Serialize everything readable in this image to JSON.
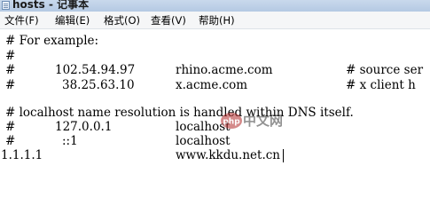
{
  "window": {
    "title": "hosts - 记事本"
  },
  "menu": {
    "file": "文件(F)",
    "edit": "编辑(E)",
    "format": "格式(O)",
    "view": "查看(V)",
    "help": "帮助(H)"
  },
  "editor": {
    "lines": [
      {
        "text": "# For example:"
      },
      {
        "text": "#"
      },
      {
        "hash": "#",
        "ip": "102.54.94.97",
        "host": "rhino.acme.com",
        "comment": "# source ser"
      },
      {
        "hash": "#",
        "ip": "38.25.63.10",
        "host": "x.acme.com",
        "comment": "# x client h"
      },
      {
        "text": ""
      },
      {
        "text": "# localhost name resolution is handled within DNS itself."
      },
      {
        "hash": "#",
        "ip": "127.0.0.1",
        "host": "localhost"
      },
      {
        "hash": "#",
        "ip": "::1",
        "host": "localhost"
      },
      {
        "ip": "1.1.1.1",
        "host": "www.kkdu.net.cn"
      }
    ]
  },
  "watermark": {
    "logo_text": "php",
    "text": "中文网",
    "logo_color": "#b22b2b"
  }
}
